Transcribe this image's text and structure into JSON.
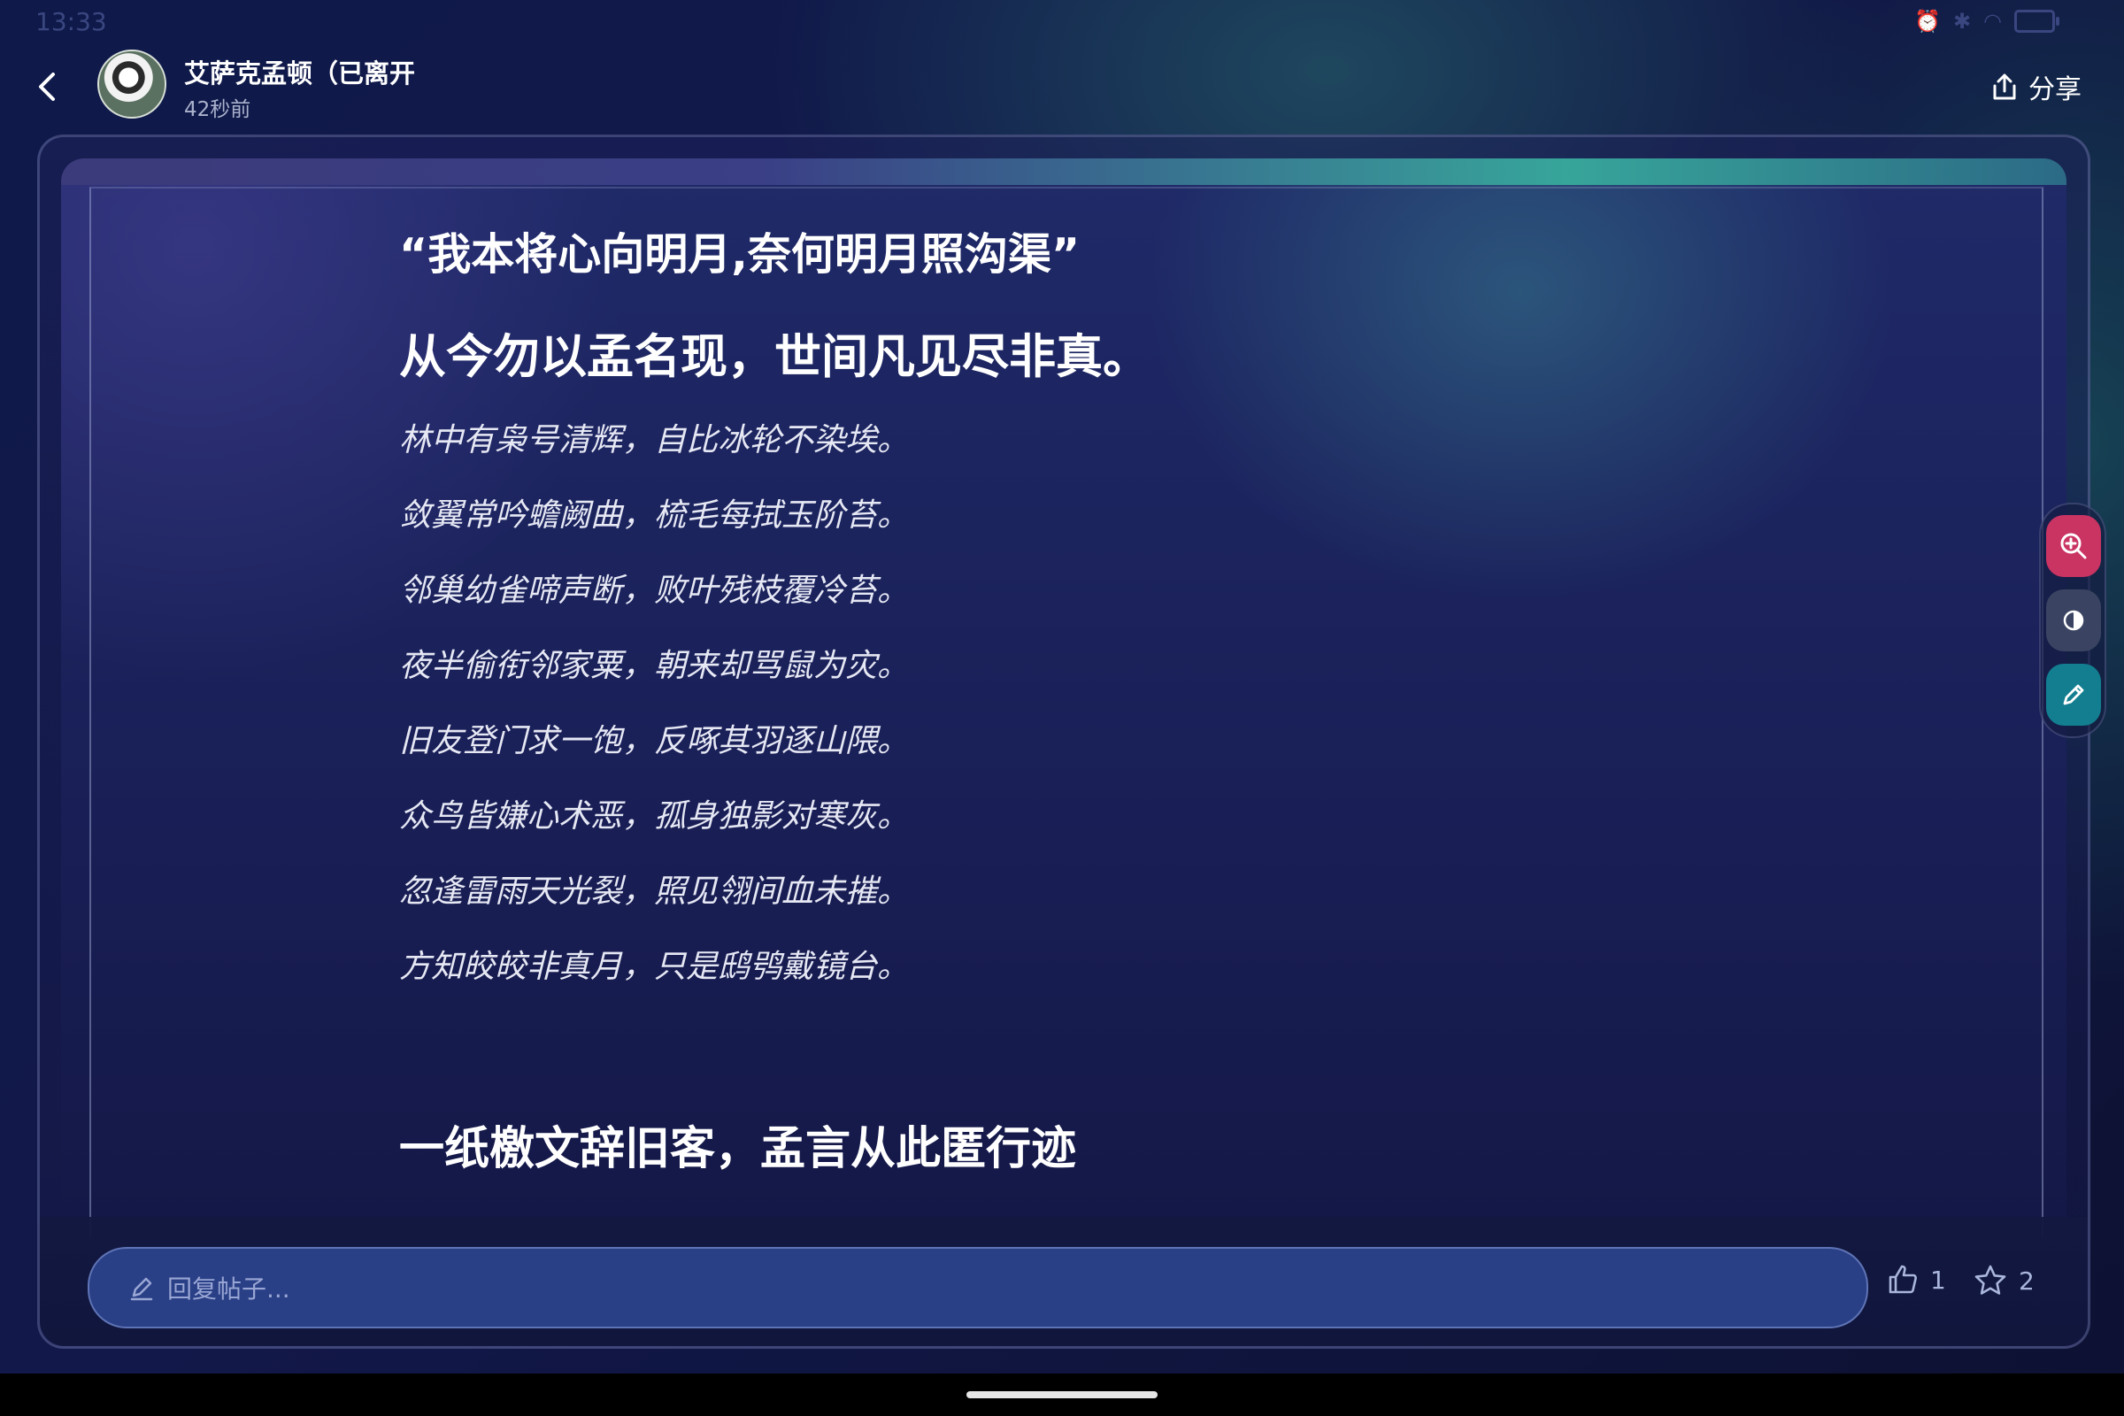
{
  "status": {
    "time": "13:33"
  },
  "header": {
    "author": "艾萨克孟顿（已离开",
    "time_ago": "42秒前",
    "share_label": "分享"
  },
  "post": {
    "heading1": "“我本将心向明月,奈何明月照沟渠”",
    "heading2": "从今勿以孟名现，世间凡见尽非真。",
    "verses": [
      "林中有枭号清辉，自比冰轮不染埃。",
      "敛翼常吟蟾阙曲，梳毛每拭玉阶苔。",
      "邻巢幼雀啼声断，败叶残枝覆冷苔。",
      "夜半偷衔邻家粟，朝来却骂鼠为灾。",
      "旧友登门求一饱，反啄其羽逐山隈。",
      "众鸟皆嫌心术恶，孤身独影对寒灰。",
      "忽逢雷雨天光裂，照见翎间血未摧。",
      "方知皎皎非真月，只是鸱鸮戴镜台。"
    ],
    "heading3": "一纸檄文辞旧客，孟言从此匿行迹"
  },
  "tools": [
    "zoom-in-icon",
    "contrast-icon",
    "pen-icon"
  ],
  "reply": {
    "placeholder": "回复帖子...",
    "like_count": "1",
    "favorite_count": "2"
  },
  "colors": {
    "zoom_tool": "#c93463",
    "contrast_tool": "#3a4462",
    "pen_tool": "#127e90",
    "reply_input": "#293f86"
  }
}
